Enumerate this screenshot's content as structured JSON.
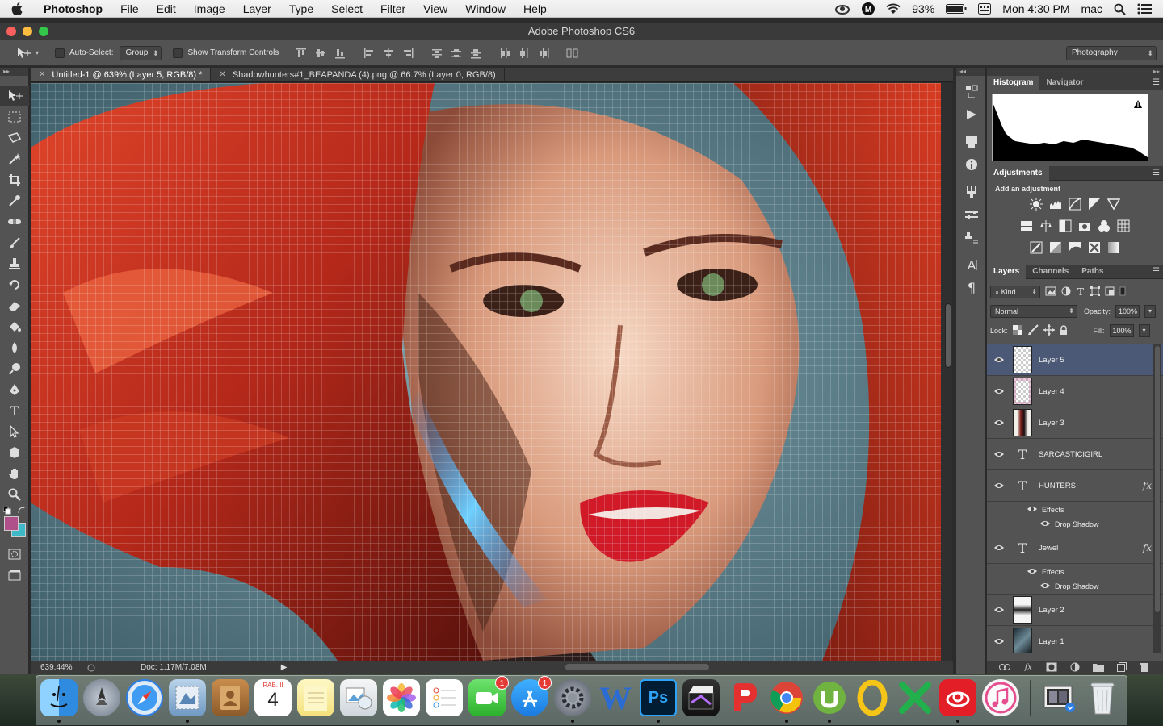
{
  "menubar": {
    "apple_icon": "apple-logo-icon",
    "app_name": "Photoshop",
    "items": [
      "File",
      "Edit",
      "Image",
      "Layer",
      "Type",
      "Select",
      "Filter",
      "View",
      "Window",
      "Help"
    ],
    "battery": "93%",
    "clock": "Mon 4:30 PM",
    "user": "mac"
  },
  "window": {
    "title": "Adobe Photoshop CS6"
  },
  "options": {
    "auto_select_label": "Auto-Select:",
    "auto_select_value": "Group",
    "transform_label": "Show Transform Controls",
    "workspace": "Photography"
  },
  "tabs": [
    {
      "label": "Untitled-1 @ 639% (Layer 5, RGB/8) *"
    },
    {
      "label": "Shadowhunters#1_BEAPANDA (4).png @ 66.7% (Layer 0, RGB/8)"
    }
  ],
  "status": {
    "zoom": "639.44%",
    "doc": "Doc: 1.17M/7.08M"
  },
  "panels": {
    "histogram_tab": "Histogram",
    "navigator_tab": "Navigator",
    "adjustments_tab": "Adjustments",
    "adjustments_title": "Add an adjustment",
    "layers_tab": "Layers",
    "channels_tab": "Channels",
    "paths_tab": "Paths",
    "kind_label": "Kind",
    "blend_mode": "Normal",
    "opacity_label": "Opacity:",
    "opacity_value": "100%",
    "lock_label": "Lock:",
    "fill_label": "Fill:",
    "fill_value": "100%"
  },
  "layers": [
    {
      "name": "Layer 5",
      "type": "pixel",
      "selected": true
    },
    {
      "name": "Layer 4",
      "type": "pixel"
    },
    {
      "name": "Layer 3",
      "type": "pixel"
    },
    {
      "name": "SARCASTICIGIRL",
      "type": "text"
    },
    {
      "name": "HUNTERS",
      "type": "text",
      "fx": true,
      "effects_label": "Effects",
      "effect": "Drop Shadow"
    },
    {
      "name": "Jewel",
      "type": "text",
      "fx": true,
      "effects_label": "Effects",
      "effect": "Drop Shadow"
    },
    {
      "name": "Layer 2",
      "type": "pixel"
    },
    {
      "name": "Layer 1",
      "type": "pixel"
    }
  ],
  "fx_glyph": "fx",
  "dock": {
    "calendar_month": "RAB. II",
    "calendar_day": "4",
    "badges": {
      "facetime": "1",
      "appstore": "1"
    },
    "word_letter": "W",
    "ps_letter": "Ps"
  },
  "colors": {
    "ui_dark": "#535353",
    "selected_layer": "#4b5876",
    "foreground_swatch": "#b0508a",
    "background_swatch": "#3fb9c7"
  }
}
